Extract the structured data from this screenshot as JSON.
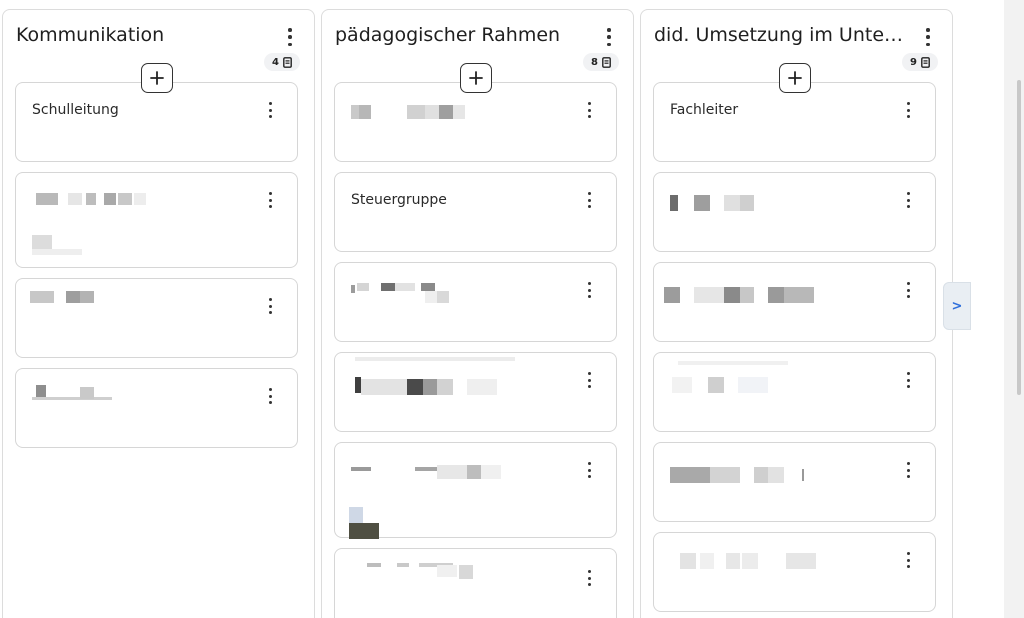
{
  "columns": [
    {
      "title": "Kommunikation",
      "count": "4",
      "cards": [
        {
          "title": "Schulleitung"
        },
        {
          "title": ""
        },
        {
          "title": ""
        },
        {
          "title": ""
        }
      ]
    },
    {
      "title": "pädagogischer Rahmen",
      "count": "8",
      "cards": [
        {
          "title": ""
        },
        {
          "title": "Steuergruppe"
        },
        {
          "title": ""
        },
        {
          "title": ""
        },
        {
          "title": ""
        },
        {
          "title": ""
        }
      ]
    },
    {
      "title": "did. Umsetzung im Unterr...",
      "count": "9",
      "cards": [
        {
          "title": "Fachleiter"
        },
        {
          "title": ""
        },
        {
          "title": ""
        },
        {
          "title": ""
        },
        {
          "title": ""
        },
        {
          "title": ""
        }
      ]
    }
  ],
  "icons": {
    "column_menu": "more-vertical-icon",
    "card_menu": "more-vertical-icon",
    "count": "document-icon",
    "add": "plus-icon",
    "next": "chevron-right-icon"
  },
  "next_label": ">",
  "accent_color": "#2f6fdb"
}
